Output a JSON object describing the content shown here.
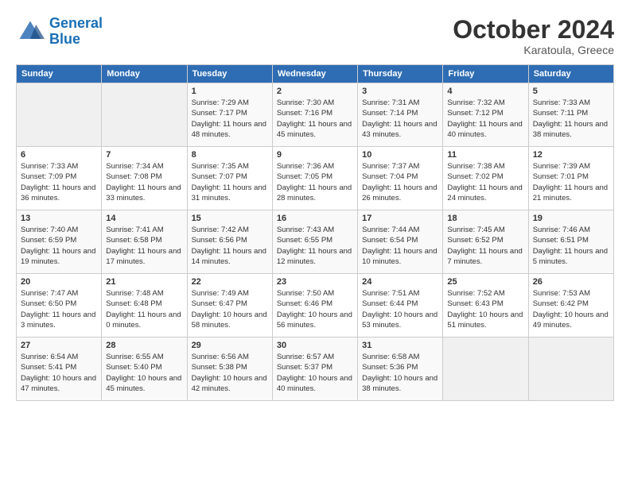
{
  "header": {
    "logo_line1": "General",
    "logo_line2": "Blue",
    "month": "October 2024",
    "location": "Karatoula, Greece"
  },
  "weekdays": [
    "Sunday",
    "Monday",
    "Tuesday",
    "Wednesday",
    "Thursday",
    "Friday",
    "Saturday"
  ],
  "weeks": [
    [
      {
        "day": "",
        "sunrise": "",
        "sunset": "",
        "daylight": ""
      },
      {
        "day": "",
        "sunrise": "",
        "sunset": "",
        "daylight": ""
      },
      {
        "day": "1",
        "sunrise": "Sunrise: 7:29 AM",
        "sunset": "Sunset: 7:17 PM",
        "daylight": "Daylight: 11 hours and 48 minutes."
      },
      {
        "day": "2",
        "sunrise": "Sunrise: 7:30 AM",
        "sunset": "Sunset: 7:16 PM",
        "daylight": "Daylight: 11 hours and 45 minutes."
      },
      {
        "day": "3",
        "sunrise": "Sunrise: 7:31 AM",
        "sunset": "Sunset: 7:14 PM",
        "daylight": "Daylight: 11 hours and 43 minutes."
      },
      {
        "day": "4",
        "sunrise": "Sunrise: 7:32 AM",
        "sunset": "Sunset: 7:12 PM",
        "daylight": "Daylight: 11 hours and 40 minutes."
      },
      {
        "day": "5",
        "sunrise": "Sunrise: 7:33 AM",
        "sunset": "Sunset: 7:11 PM",
        "daylight": "Daylight: 11 hours and 38 minutes."
      }
    ],
    [
      {
        "day": "6",
        "sunrise": "Sunrise: 7:33 AM",
        "sunset": "Sunset: 7:09 PM",
        "daylight": "Daylight: 11 hours and 36 minutes."
      },
      {
        "day": "7",
        "sunrise": "Sunrise: 7:34 AM",
        "sunset": "Sunset: 7:08 PM",
        "daylight": "Daylight: 11 hours and 33 minutes."
      },
      {
        "day": "8",
        "sunrise": "Sunrise: 7:35 AM",
        "sunset": "Sunset: 7:07 PM",
        "daylight": "Daylight: 11 hours and 31 minutes."
      },
      {
        "day": "9",
        "sunrise": "Sunrise: 7:36 AM",
        "sunset": "Sunset: 7:05 PM",
        "daylight": "Daylight: 11 hours and 28 minutes."
      },
      {
        "day": "10",
        "sunrise": "Sunrise: 7:37 AM",
        "sunset": "Sunset: 7:04 PM",
        "daylight": "Daylight: 11 hours and 26 minutes."
      },
      {
        "day": "11",
        "sunrise": "Sunrise: 7:38 AM",
        "sunset": "Sunset: 7:02 PM",
        "daylight": "Daylight: 11 hours and 24 minutes."
      },
      {
        "day": "12",
        "sunrise": "Sunrise: 7:39 AM",
        "sunset": "Sunset: 7:01 PM",
        "daylight": "Daylight: 11 hours and 21 minutes."
      }
    ],
    [
      {
        "day": "13",
        "sunrise": "Sunrise: 7:40 AM",
        "sunset": "Sunset: 6:59 PM",
        "daylight": "Daylight: 11 hours and 19 minutes."
      },
      {
        "day": "14",
        "sunrise": "Sunrise: 7:41 AM",
        "sunset": "Sunset: 6:58 PM",
        "daylight": "Daylight: 11 hours and 17 minutes."
      },
      {
        "day": "15",
        "sunrise": "Sunrise: 7:42 AM",
        "sunset": "Sunset: 6:56 PM",
        "daylight": "Daylight: 11 hours and 14 minutes."
      },
      {
        "day": "16",
        "sunrise": "Sunrise: 7:43 AM",
        "sunset": "Sunset: 6:55 PM",
        "daylight": "Daylight: 11 hours and 12 minutes."
      },
      {
        "day": "17",
        "sunrise": "Sunrise: 7:44 AM",
        "sunset": "Sunset: 6:54 PM",
        "daylight": "Daylight: 11 hours and 10 minutes."
      },
      {
        "day": "18",
        "sunrise": "Sunrise: 7:45 AM",
        "sunset": "Sunset: 6:52 PM",
        "daylight": "Daylight: 11 hours and 7 minutes."
      },
      {
        "day": "19",
        "sunrise": "Sunrise: 7:46 AM",
        "sunset": "Sunset: 6:51 PM",
        "daylight": "Daylight: 11 hours and 5 minutes."
      }
    ],
    [
      {
        "day": "20",
        "sunrise": "Sunrise: 7:47 AM",
        "sunset": "Sunset: 6:50 PM",
        "daylight": "Daylight: 11 hours and 3 minutes."
      },
      {
        "day": "21",
        "sunrise": "Sunrise: 7:48 AM",
        "sunset": "Sunset: 6:48 PM",
        "daylight": "Daylight: 11 hours and 0 minutes."
      },
      {
        "day": "22",
        "sunrise": "Sunrise: 7:49 AM",
        "sunset": "Sunset: 6:47 PM",
        "daylight": "Daylight: 10 hours and 58 minutes."
      },
      {
        "day": "23",
        "sunrise": "Sunrise: 7:50 AM",
        "sunset": "Sunset: 6:46 PM",
        "daylight": "Daylight: 10 hours and 56 minutes."
      },
      {
        "day": "24",
        "sunrise": "Sunrise: 7:51 AM",
        "sunset": "Sunset: 6:44 PM",
        "daylight": "Daylight: 10 hours and 53 minutes."
      },
      {
        "day": "25",
        "sunrise": "Sunrise: 7:52 AM",
        "sunset": "Sunset: 6:43 PM",
        "daylight": "Daylight: 10 hours and 51 minutes."
      },
      {
        "day": "26",
        "sunrise": "Sunrise: 7:53 AM",
        "sunset": "Sunset: 6:42 PM",
        "daylight": "Daylight: 10 hours and 49 minutes."
      }
    ],
    [
      {
        "day": "27",
        "sunrise": "Sunrise: 6:54 AM",
        "sunset": "Sunset: 5:41 PM",
        "daylight": "Daylight: 10 hours and 47 minutes."
      },
      {
        "day": "28",
        "sunrise": "Sunrise: 6:55 AM",
        "sunset": "Sunset: 5:40 PM",
        "daylight": "Daylight: 10 hours and 45 minutes."
      },
      {
        "day": "29",
        "sunrise": "Sunrise: 6:56 AM",
        "sunset": "Sunset: 5:38 PM",
        "daylight": "Daylight: 10 hours and 42 minutes."
      },
      {
        "day": "30",
        "sunrise": "Sunrise: 6:57 AM",
        "sunset": "Sunset: 5:37 PM",
        "daylight": "Daylight: 10 hours and 40 minutes."
      },
      {
        "day": "31",
        "sunrise": "Sunrise: 6:58 AM",
        "sunset": "Sunset: 5:36 PM",
        "daylight": "Daylight: 10 hours and 38 minutes."
      },
      {
        "day": "",
        "sunrise": "",
        "sunset": "",
        "daylight": ""
      },
      {
        "day": "",
        "sunrise": "",
        "sunset": "",
        "daylight": ""
      }
    ]
  ]
}
